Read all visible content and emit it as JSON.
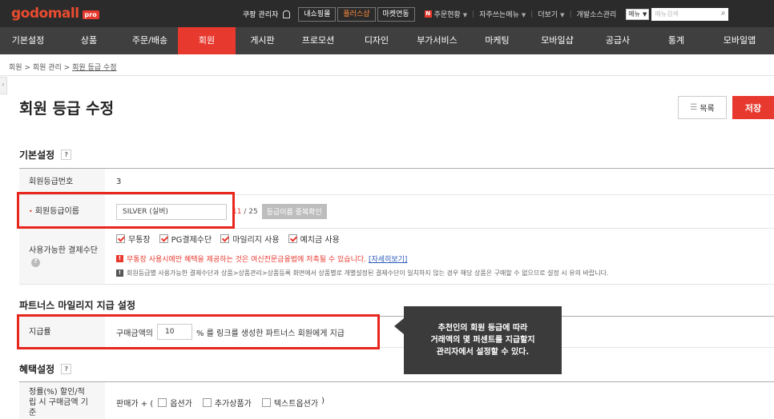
{
  "topbar": {
    "logo_text": "godomall",
    "logo_badge": "pro",
    "admin_label": "쿠팡 관리자",
    "btn_mystore": "내쇼핑몰",
    "btn_playstore": "플러스샵",
    "btn_marketing": "마켓연동",
    "order_status": "주문현황",
    "order_badge": "N",
    "favorite_menu": "자주쓰는메뉴",
    "more": "더보기",
    "dev_source": "개발소스관리",
    "menu_select": "메뉴",
    "menu_search_placeholder": "메뉴검색"
  },
  "nav": {
    "items": [
      "기본설정",
      "상품",
      "주문/배송",
      "회원",
      "게시판",
      "프로모션",
      "디자인",
      "부가서비스",
      "마케팅",
      "모바일샵",
      "공급사",
      "통계",
      "모바일앱"
    ],
    "active": "회원"
  },
  "breadcrumb": {
    "items": [
      "회원",
      "회원 관리",
      "회원 등급 수정"
    ]
  },
  "page": {
    "title": "회원 등급 수정",
    "list_button": "목록",
    "save_button": "저장"
  },
  "section_basic": {
    "title": "기본설정",
    "help": "?",
    "grade_no_label": "회원등급번호",
    "grade_no_value": "3",
    "grade_name_label": "회원등급이름",
    "grade_name_value": "SILVER (실버)",
    "char_count": "11",
    "char_max": "/ 25",
    "dup_check_button": "등급이름 중복확인",
    "payment_label": "사용가능한 결제수단",
    "payment_options": [
      {
        "label": "무통장",
        "checked": true
      },
      {
        "label": "PG결제수단",
        "checked": true
      },
      {
        "label": "마일리지 사용",
        "checked": true
      },
      {
        "label": "예치금 사용",
        "checked": true
      }
    ],
    "notice_red": "무통장 사용시에만 혜택을 제공하는 것은 여신전문금융법에 저촉될 수 있습니다.",
    "notice_link": "[자세히보기]",
    "notice_gray": "회원등급별 사용가능한 결제수단과 상품>상품관리>상품등록 화면에서 상품별로 개별설정된 결제수단이 일치하지 않는 경우 해당 상품은 구매할 수 없으므로 설정 시 유의 바랍니다."
  },
  "section_partner": {
    "title": "파트너스 마일리지 지급 설정",
    "rate_label": "지급률",
    "rate_prefix": "구매금액의",
    "rate_value": "10",
    "rate_suffix": "% 를 링크를 생성한 파트너스 회원에게 지급"
  },
  "section_benefit": {
    "title": "혜택설정",
    "help": "?",
    "discount_label": "정률(%) 할인/적립 시 구매금액 기준",
    "price_base": "판매가 + (",
    "options": [
      "옵션가",
      "추가상품가",
      "텍스트옵션가"
    ],
    "close_paren": ")"
  },
  "tooltip": {
    "lines": [
      "추천인의 회원 등급에 따라",
      "거래액의 몇 퍼센트를 지급할지",
      "관리자에서 설정할 수 있다."
    ]
  },
  "colors": {
    "accent": "#e8392f",
    "nav_bg": "#3f3f3f",
    "topbar_bg": "#2b2b2b",
    "highlight": "#e8261d"
  }
}
